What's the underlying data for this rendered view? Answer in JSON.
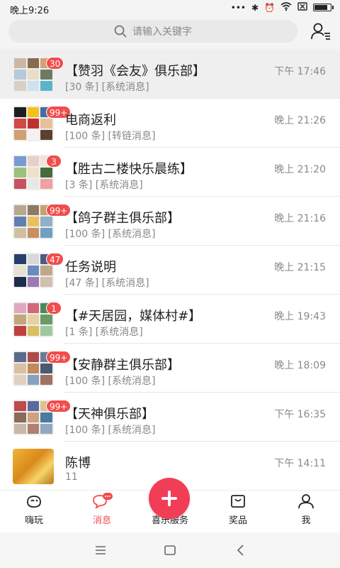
{
  "status_bar": {
    "time": "晚上9:26",
    "battery_level": 0.9
  },
  "search": {
    "placeholder": "请输入关键字",
    "icon": "search-icon"
  },
  "header": {
    "contacts_icon": "contacts-icon"
  },
  "conversations": [
    {
      "title": "【赞羽《会友》俱乐部】",
      "subtitle": "[30 条] [系统消息]",
      "time": "下午 17:46",
      "badge": "30",
      "active": true,
      "colors": [
        "#c9b8a6",
        "#8a6a4e",
        "#d7a073",
        "#b4c9d9",
        "#e9dcc8",
        "#6c7a62",
        "#d8d0c4",
        "#cfe0ee",
        "#5ab4c9"
      ]
    },
    {
      "title": "电商返利",
      "subtitle": "[100 条] [转链消息]",
      "time": "晚上 21:26",
      "badge": "99+",
      "colors": [
        "#1e1e1e",
        "#f5c01a",
        "#3e6fa5",
        "#d24848",
        "#c03030",
        "#e8c09a",
        "#d0a070",
        "#f2f2f2",
        "#5a4030"
      ]
    },
    {
      "title": "【胜古二楼快乐晨练】",
      "subtitle": "[3 条] [系统消息]",
      "time": "晚上 21:20",
      "badge": "3",
      "colors": [
        "#7a9ad0",
        "#e7d0c8",
        "#f0e3d8",
        "#9ac27a",
        "#f0e0c8",
        "#4a6a3a",
        "#c85060",
        "#e8e8e8",
        "#f0a0a0"
      ]
    },
    {
      "title": "【鸽子群主俱乐部】",
      "subtitle": "[100 条] [系统消息]",
      "time": "晚上 21:16",
      "badge": "99+",
      "colors": [
        "#b8a890",
        "#8e7a62",
        "#c8a070",
        "#6080b0",
        "#e8c060",
        "#90b0c8",
        "#d0c0a0",
        "#c89060",
        "#70a0c0"
      ]
    },
    {
      "title": "任务说明",
      "subtitle": "[47 条] [系统消息]",
      "time": "晚上 21:15",
      "badge": "47",
      "colors": [
        "#2a3e6a",
        "#d8d8d8",
        "#4a5a80",
        "#e8e0d0",
        "#6a8ac0",
        "#c0a888",
        "#1e2c4e",
        "#9a7ab0",
        "#d0c0b0"
      ]
    },
    {
      "title": "【#天居园，媒体村#】",
      "subtitle": "[1 条] [系统消息]",
      "time": "晚上 19:43",
      "badge": "1",
      "colors": [
        "#e0a8c0",
        "#d06878",
        "#4a8a5a",
        "#c0a878",
        "#e8d0a0",
        "#6a9a6a",
        "#c04040",
        "#d8c060",
        "#a0c8a0"
      ]
    },
    {
      "title": "【安静群主俱乐部】",
      "subtitle": "[100 条] [系统消息]",
      "time": "晚上 18:09",
      "badge": "99+",
      "colors": [
        "#5a6a88",
        "#b04a4a",
        "#6a7a9a",
        "#d8c0a0",
        "#c08a5a",
        "#4a5a70",
        "#e0d0c0",
        "#8aa0c0",
        "#a07060"
      ]
    },
    {
      "title": "【天神俱乐部】",
      "subtitle": "[100 条] [系统消息]",
      "time": "下午 16:35",
      "badge": "99+",
      "colors": [
        "#c04a4a",
        "#5a6a9a",
        "#e0c090",
        "#8a6a5a",
        "#d0a080",
        "#4a7aa0",
        "#c8b8a8",
        "#b08070",
        "#90a8c0"
      ]
    },
    {
      "title": "陈博",
      "subtitle": "11",
      "time": "下午 14:11",
      "badge": "",
      "single": true,
      "colors": []
    }
  ],
  "tabs": [
    {
      "label": "嗨玩",
      "icon": "game-icon",
      "active": false
    },
    {
      "label": "消息",
      "icon": "chat-bubble-icon",
      "active": true
    },
    {
      "label": "喜乐服务",
      "icon": "plus-icon",
      "active": false
    },
    {
      "label": "奖品",
      "icon": "gift-box-icon",
      "active": false
    },
    {
      "label": "我",
      "icon": "person-icon",
      "active": false
    }
  ],
  "colors": {
    "accent": "#f24c4c",
    "center_button": "#f23d57"
  }
}
